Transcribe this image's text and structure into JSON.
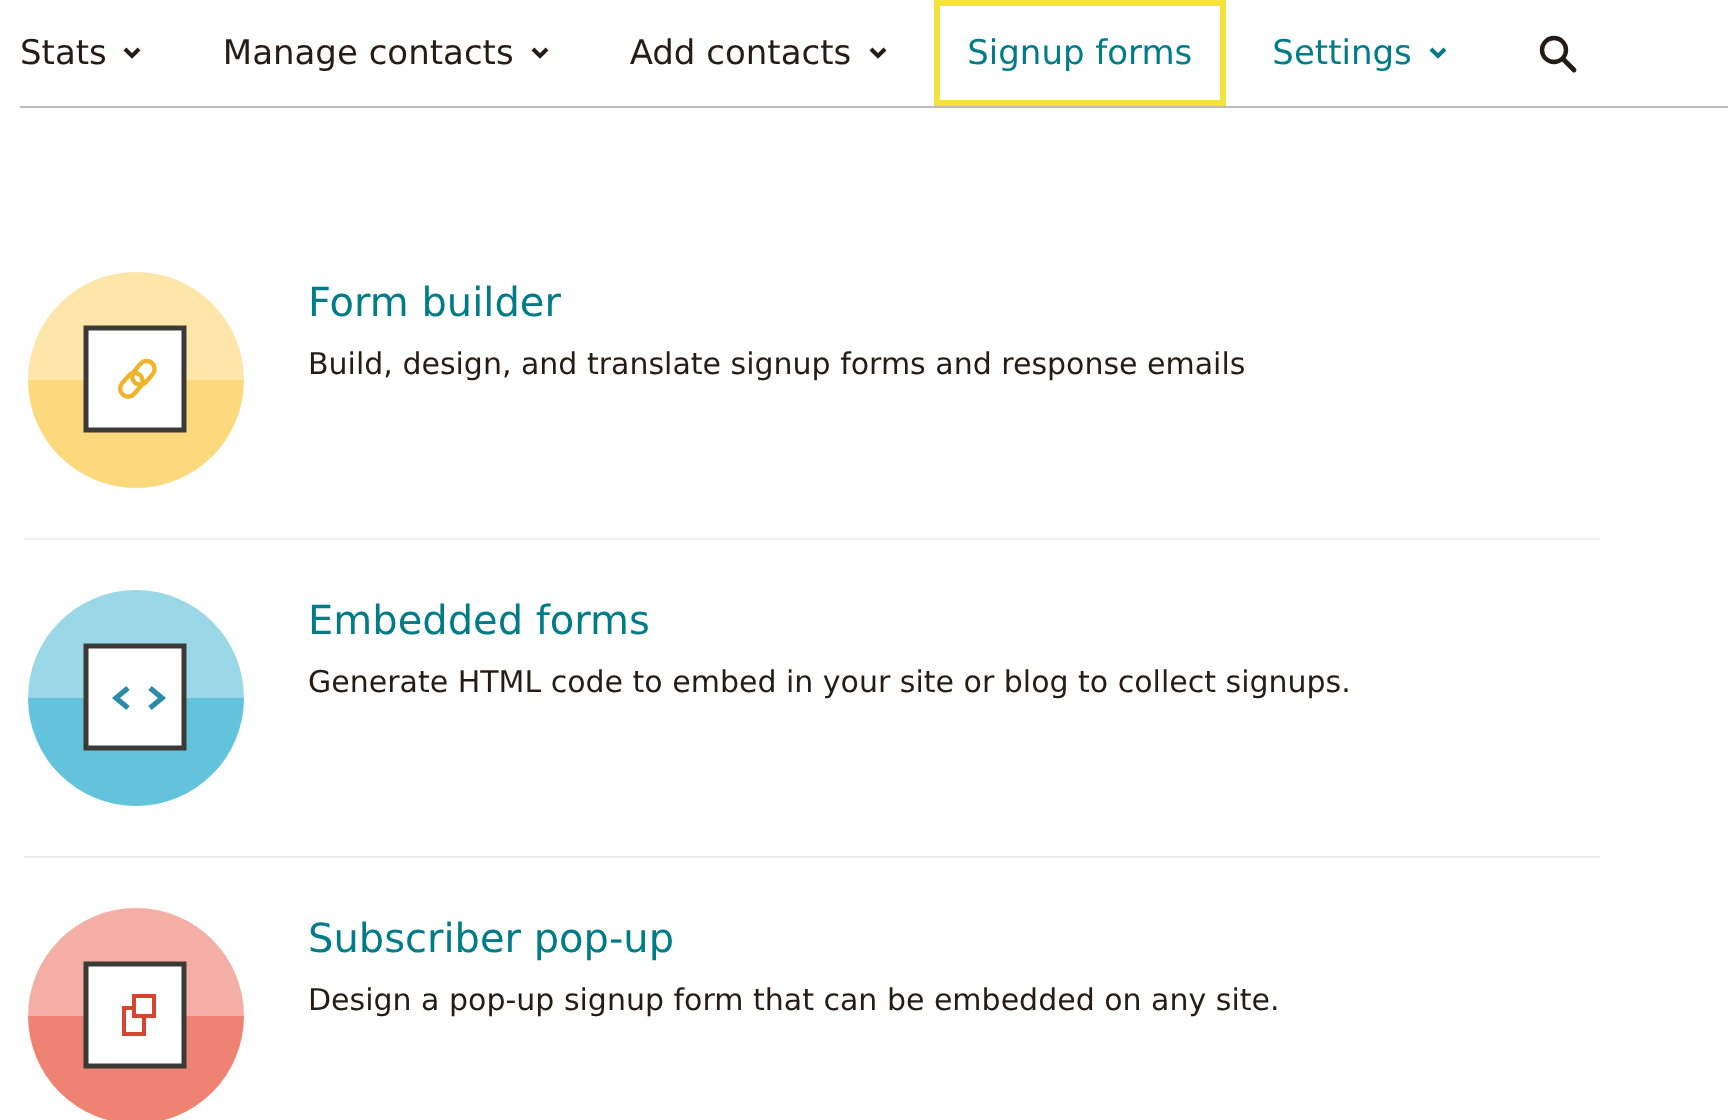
{
  "nav": [
    {
      "label": "Stats",
      "dropdown": true,
      "selected": false,
      "color": "#241c15"
    },
    {
      "label": "Manage contacts",
      "dropdown": true,
      "selected": false,
      "color": "#241c15"
    },
    {
      "label": "Add contacts",
      "dropdown": true,
      "selected": false,
      "color": "#241c15"
    },
    {
      "label": "Signup forms",
      "dropdown": false,
      "selected": true,
      "color": "#007c89"
    },
    {
      "label": "Settings",
      "dropdown": true,
      "selected": false,
      "color": "#007c89"
    }
  ],
  "options": [
    {
      "kind": "link",
      "color": "#fdd97e",
      "title": "Form builder",
      "description": "Build, design, and translate signup forms and response emails"
    },
    {
      "kind": "code",
      "color": "#63c3dc",
      "title": "Embedded forms",
      "description": "Generate HTML code to embed in your site or blog to collect signups."
    },
    {
      "kind": "popup",
      "color": "#ee8373",
      "title": "Subscriber pop-up",
      "description": "Design a pop-up signup form that can be embedded on any site."
    }
  ]
}
